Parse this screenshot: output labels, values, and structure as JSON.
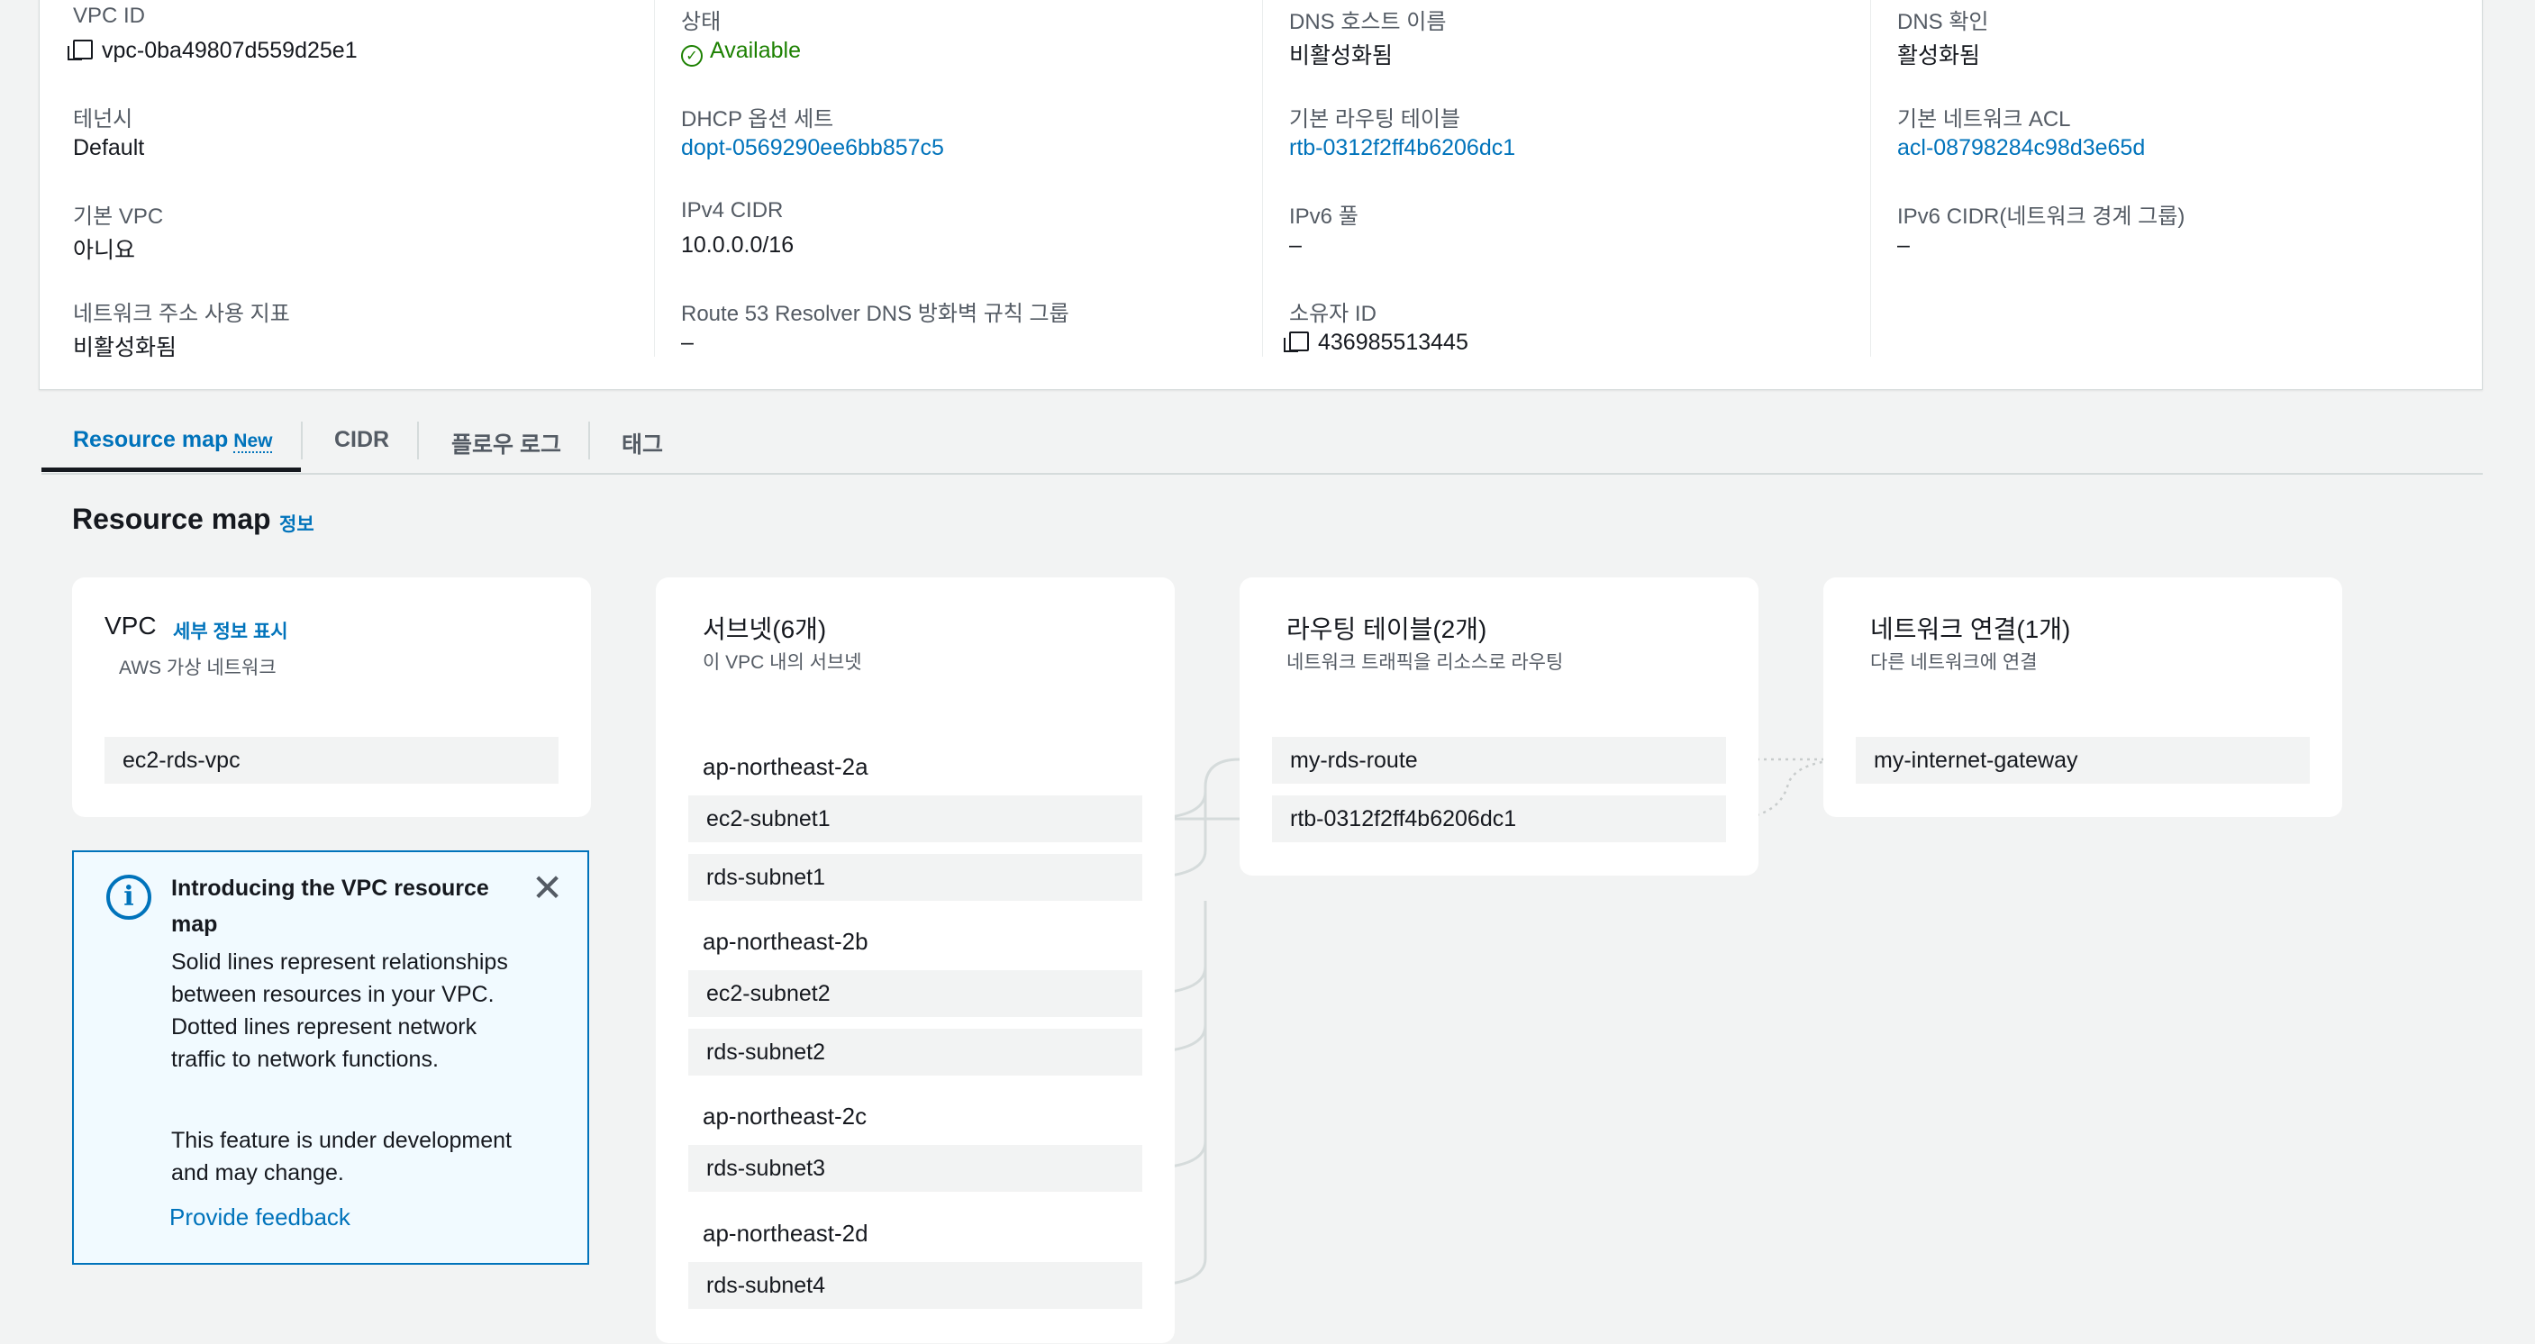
{
  "details": {
    "col1": [
      {
        "label": "VPC ID",
        "value": "vpc-0ba49807d559d25e1",
        "copy": true
      },
      {
        "label": "테넌시",
        "value": "Default"
      },
      {
        "label": "기본 VPC",
        "value": "아니요"
      },
      {
        "label": "네트워크 주소 사용 지표",
        "value": "비활성화됨"
      }
    ],
    "col2": [
      {
        "label": "상태",
        "value": "Available",
        "status": "ok"
      },
      {
        "label": "DHCP 옵션 세트",
        "value": "dopt-0569290ee6bb857c5",
        "link": true
      },
      {
        "label": "IPv4 CIDR",
        "value": "10.0.0.0/16"
      },
      {
        "label": "Route 53 Resolver DNS 방화벽 규칙 그룹",
        "value": "–"
      }
    ],
    "col3": [
      {
        "label": "DNS 호스트 이름",
        "value": "비활성화됨"
      },
      {
        "label": "기본 라우팅 테이블",
        "value": "rtb-0312f2ff4b6206dc1",
        "link": true
      },
      {
        "label": "IPv6 풀",
        "value": "–"
      },
      {
        "label": "소유자 ID",
        "value": "436985513445",
        "copy": true
      }
    ],
    "col4": [
      {
        "label": "DNS 확인",
        "value": "활성화됨"
      },
      {
        "label": "기본 네트워크 ACL",
        "value": "acl-08798284c98d3e65d",
        "link": true
      },
      {
        "label": "IPv6 CIDR(네트워크 경계 그룹)",
        "value": "–"
      }
    ]
  },
  "tabs": [
    {
      "label": "Resource map",
      "badge": "New",
      "active": true
    },
    {
      "label": "CIDR"
    },
    {
      "label": "플로우 로그"
    },
    {
      "label": "태그"
    }
  ],
  "resource_map": {
    "title": "Resource map",
    "info_link": "정보",
    "vpc_card": {
      "title": "VPC",
      "details_link": "세부 정보 표시",
      "subtitle": "AWS 가상 네트워크",
      "item": "ec2-rds-vpc"
    },
    "subnets_card": {
      "title": "서브넷(6개)",
      "subtitle": "이 VPC 내의 서브넷",
      "groups": [
        {
          "az": "ap-northeast-2a",
          "subnets": [
            "ec2-subnet1",
            "rds-subnet1"
          ]
        },
        {
          "az": "ap-northeast-2b",
          "subnets": [
            "ec2-subnet2",
            "rds-subnet2"
          ]
        },
        {
          "az": "ap-northeast-2c",
          "subnets": [
            "rds-subnet3"
          ]
        },
        {
          "az": "ap-northeast-2d",
          "subnets": [
            "rds-subnet4"
          ]
        }
      ]
    },
    "route_tables_card": {
      "title": "라우팅 테이블(2개)",
      "subtitle": "네트워크 트래픽을 리소스로 라우팅",
      "items": [
        "my-rds-route",
        "rtb-0312f2ff4b6206dc1"
      ]
    },
    "network_card": {
      "title": "네트워크 연결(1개)",
      "subtitle": "다른 네트워크에 연결",
      "items": [
        "my-internet-gateway"
      ]
    }
  },
  "info_box": {
    "title": "Introducing the VPC resource map",
    "body1": "Solid lines represent relationships between resources in your VPC. Dotted lines represent network traffic to network functions.",
    "body2": "This feature is under development and may change.",
    "feedback": "Provide feedback"
  },
  "colors": {
    "link": "#0073bb",
    "ok": "#1d8102",
    "background": "#f2f3f3",
    "connector": "#d5dbdb"
  }
}
